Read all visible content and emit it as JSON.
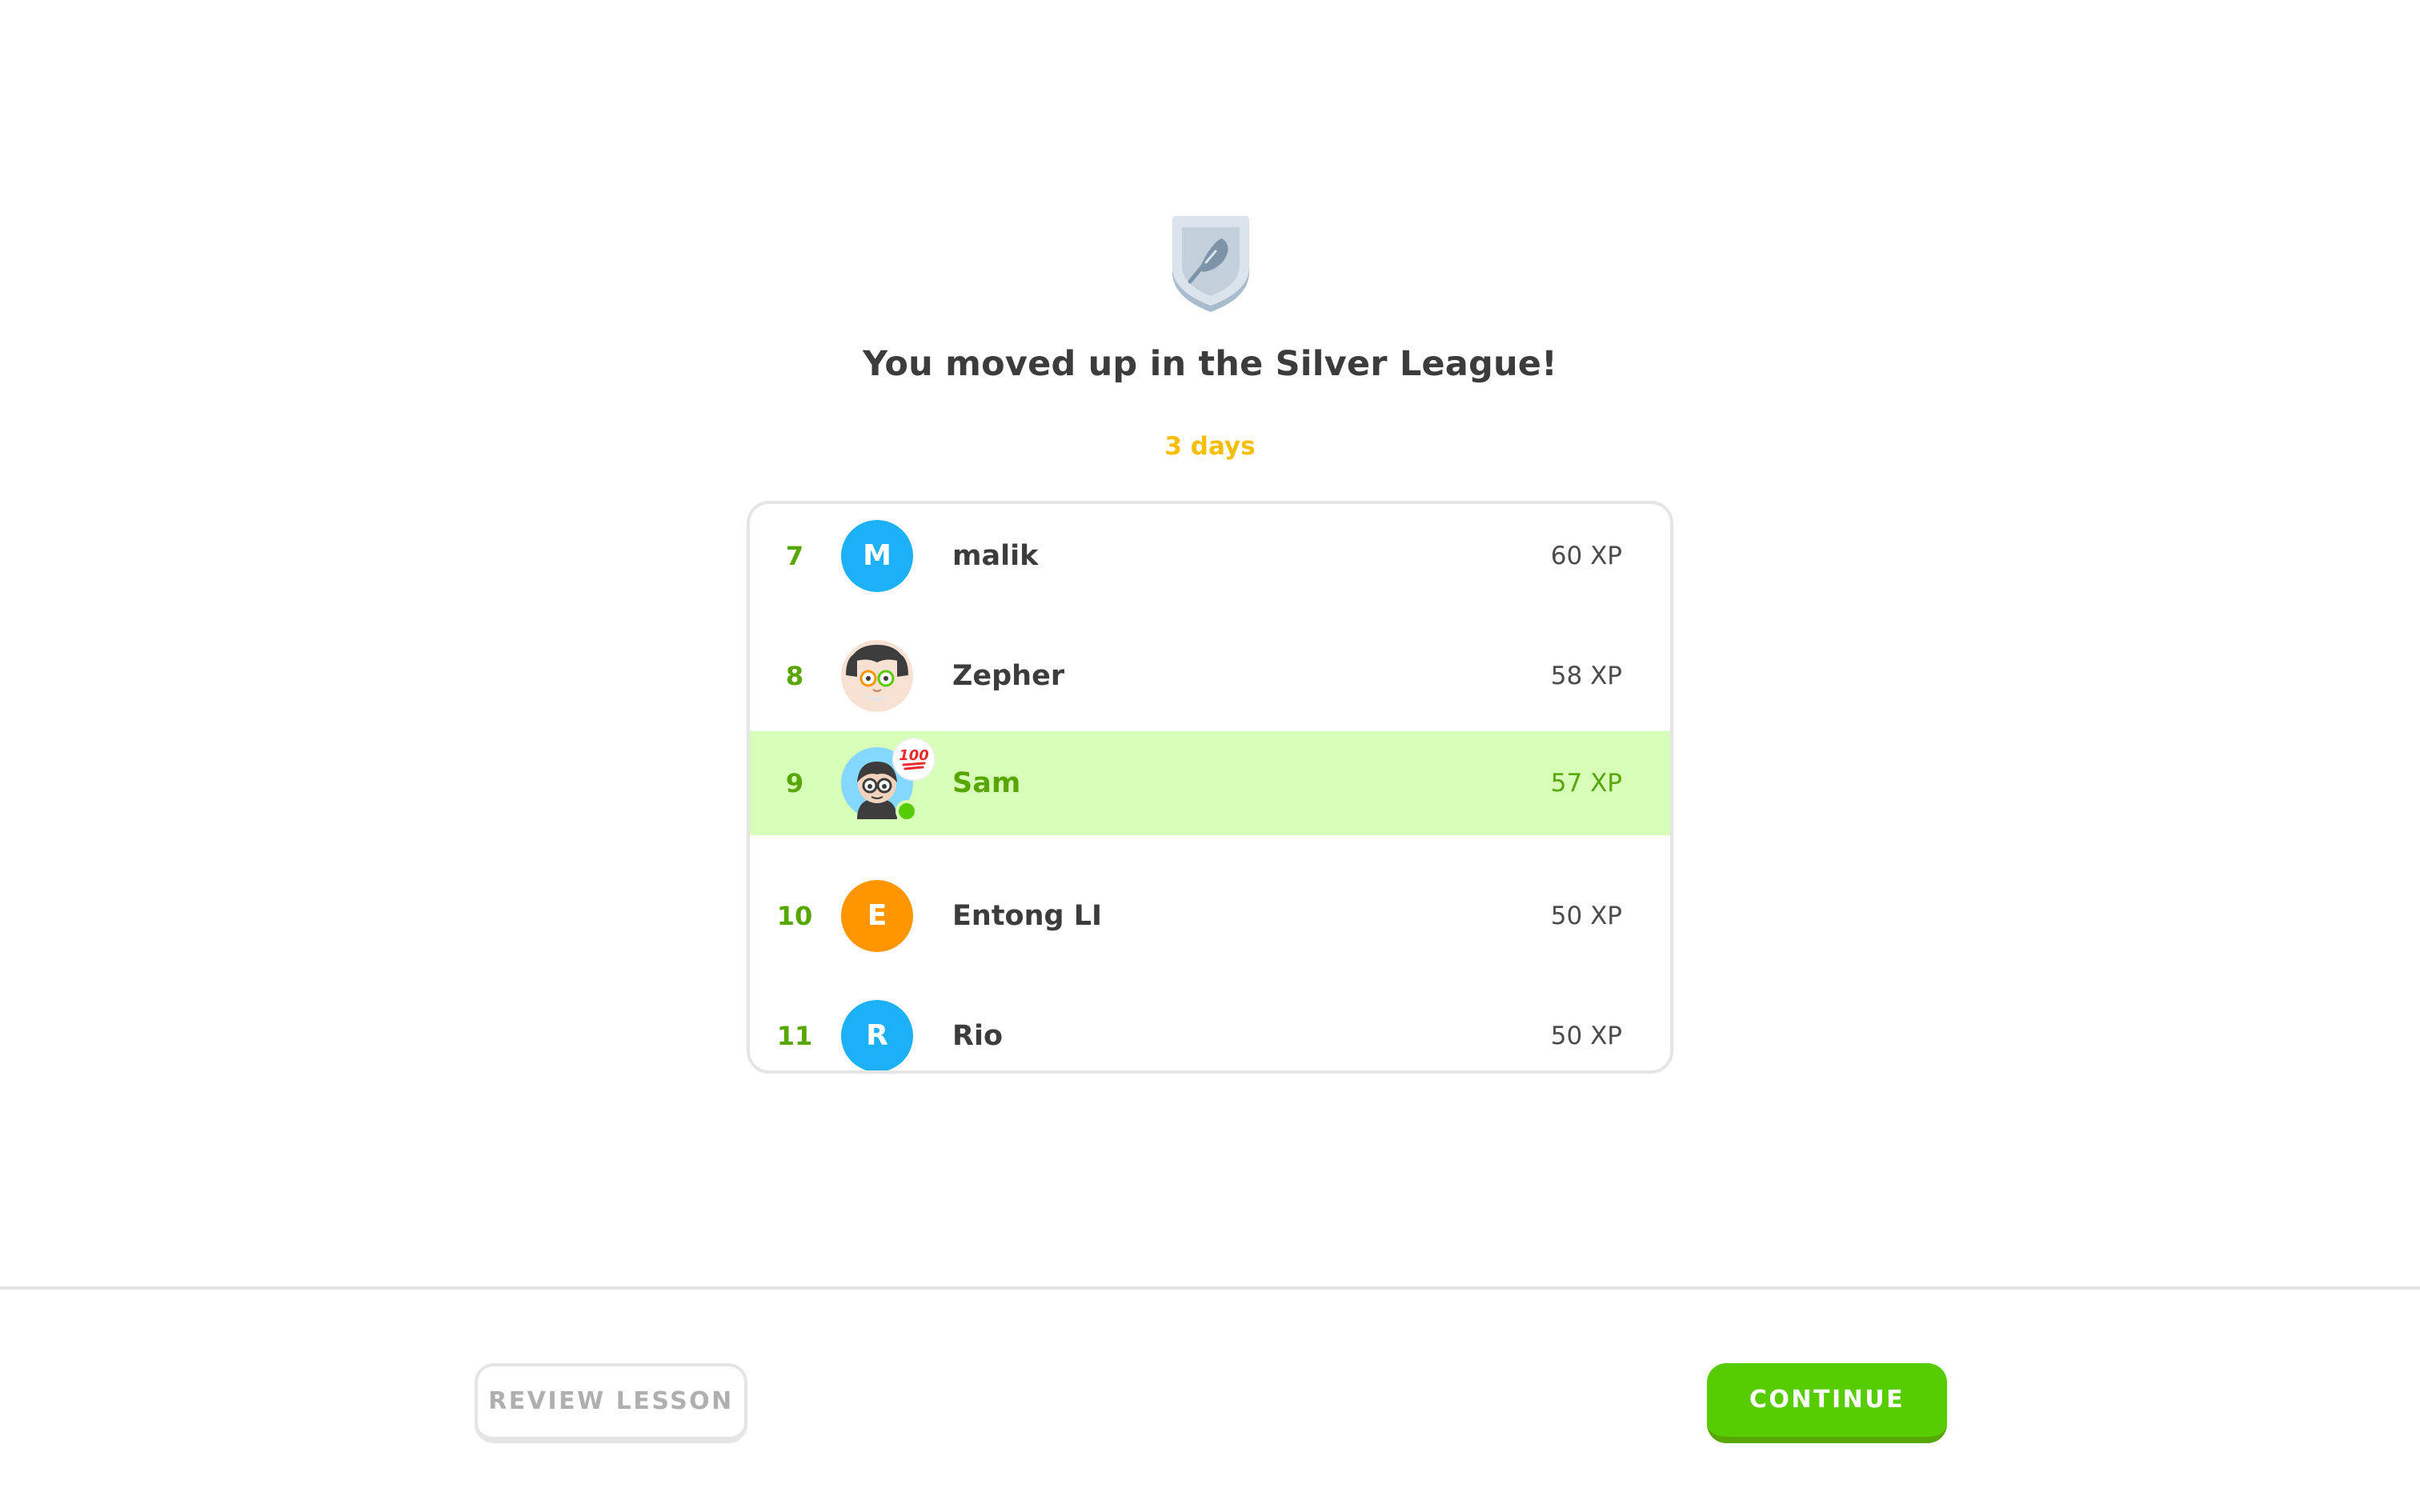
{
  "league": {
    "title": "You moved up in the Silver League!",
    "time_left": "3 days",
    "badge_icon": "silver-shield-feather-icon"
  },
  "leaderboard": {
    "rows": [
      {
        "rank": "7",
        "initial": "M",
        "name": "malik",
        "xp": "60 XP",
        "avatar_color": "#1cb0f6",
        "avatar_type": "initial"
      },
      {
        "rank": "8",
        "initial": "",
        "name": "Zepher",
        "xp": "58 XP",
        "avatar_type": "character"
      },
      {
        "rank": "9",
        "initial": "",
        "name": "Sam",
        "xp": "57 XP",
        "avatar_type": "character",
        "is_current_user": true,
        "status_emoji": "💯"
      },
      {
        "rank": "10",
        "initial": "E",
        "name": "Entong LI",
        "xp": "50 XP",
        "avatar_color": "#ff9600",
        "avatar_type": "initial"
      },
      {
        "rank": "11",
        "initial": "R",
        "name": "Rio",
        "xp": "50 XP",
        "avatar_color": "#1cb0f6",
        "avatar_type": "initial"
      }
    ]
  },
  "footer": {
    "review_label": "REVIEW LESSON",
    "continue_label": "CONTINUE"
  },
  "colors": {
    "accent_green": "#58cc02",
    "highlight_row": "#d7ffb8",
    "rank_green": "#58a700",
    "time_yellow": "#f5bf00"
  }
}
